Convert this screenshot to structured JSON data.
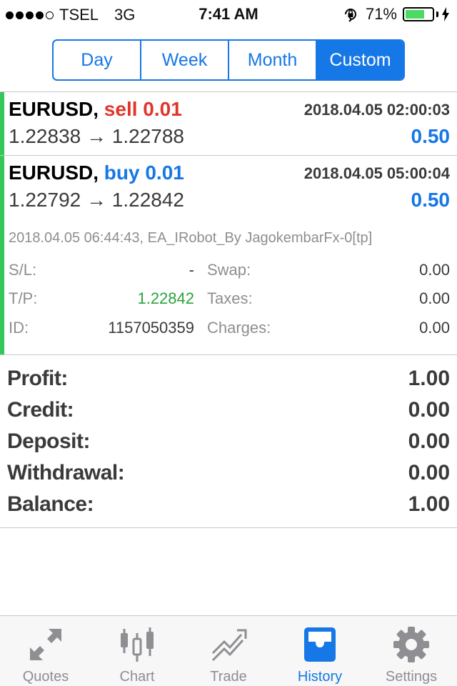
{
  "status_bar": {
    "carrier": "TSEL",
    "network": "3G",
    "time": "7:41 AM",
    "battery": "71%",
    "battery_level": 0.71,
    "signal_bars": 4,
    "signal_max": 5,
    "icons": [
      "signal-dots-icon",
      "orientation-lock-icon",
      "battery-icon",
      "charging-bolt-icon"
    ]
  },
  "period_tabs": [
    {
      "label": "Day",
      "active": false
    },
    {
      "label": "Week",
      "active": false
    },
    {
      "label": "Month",
      "active": false
    },
    {
      "label": "Custom",
      "active": true
    }
  ],
  "deals": [
    {
      "symbol": "EURUSD,",
      "side": "sell",
      "volume": "0.01",
      "time": "2018.04.05 02:00:03",
      "open_price": "1.22838",
      "arrow": "→",
      "close_price": "1.22788",
      "profit": "0.50"
    },
    {
      "symbol": "EURUSD,",
      "side": "buy",
      "volume": "0.01",
      "time": "2018.04.05 05:00:04",
      "open_price": "1.22792",
      "arrow": "→",
      "close_price": "1.22842",
      "profit": "0.50",
      "details": {
        "comment": "2018.04.05 06:44:43, EA_IRobot_By JagokembarFx-0[tp]",
        "sl_label": "S/L:",
        "sl_value": "-",
        "tp_label": "T/P:",
        "tp_value": "1.22842",
        "id_label": "ID:",
        "id_value": "1157050359",
        "swap_label": "Swap:",
        "swap_value": "0.00",
        "taxes_label": "Taxes:",
        "taxes_value": "0.00",
        "charges_label": "Charges:",
        "charges_value": "0.00"
      }
    }
  ],
  "summary": [
    {
      "label": "Profit:",
      "value": "1.00"
    },
    {
      "label": "Credit:",
      "value": "0.00"
    },
    {
      "label": "Deposit:",
      "value": "0.00"
    },
    {
      "label": "Withdrawal:",
      "value": "0.00"
    },
    {
      "label": "Balance:",
      "value": "1.00"
    }
  ],
  "tab_bar": [
    {
      "label": "Quotes",
      "icon": "quotes-arrows-icon",
      "active": false
    },
    {
      "label": "Chart",
      "icon": "candlestick-icon",
      "active": false
    },
    {
      "label": "Trade",
      "icon": "trend-line-icon",
      "active": false
    },
    {
      "label": "History",
      "icon": "inbox-tray-icon",
      "active": true
    },
    {
      "label": "Settings",
      "icon": "gear-icon",
      "active": false
    }
  ],
  "colors": {
    "accent": "#1677e6",
    "sell": "#e0352b",
    "take_profit": "#2aa43c",
    "deal_bar": "#34c759",
    "battery": "#4cd964"
  }
}
